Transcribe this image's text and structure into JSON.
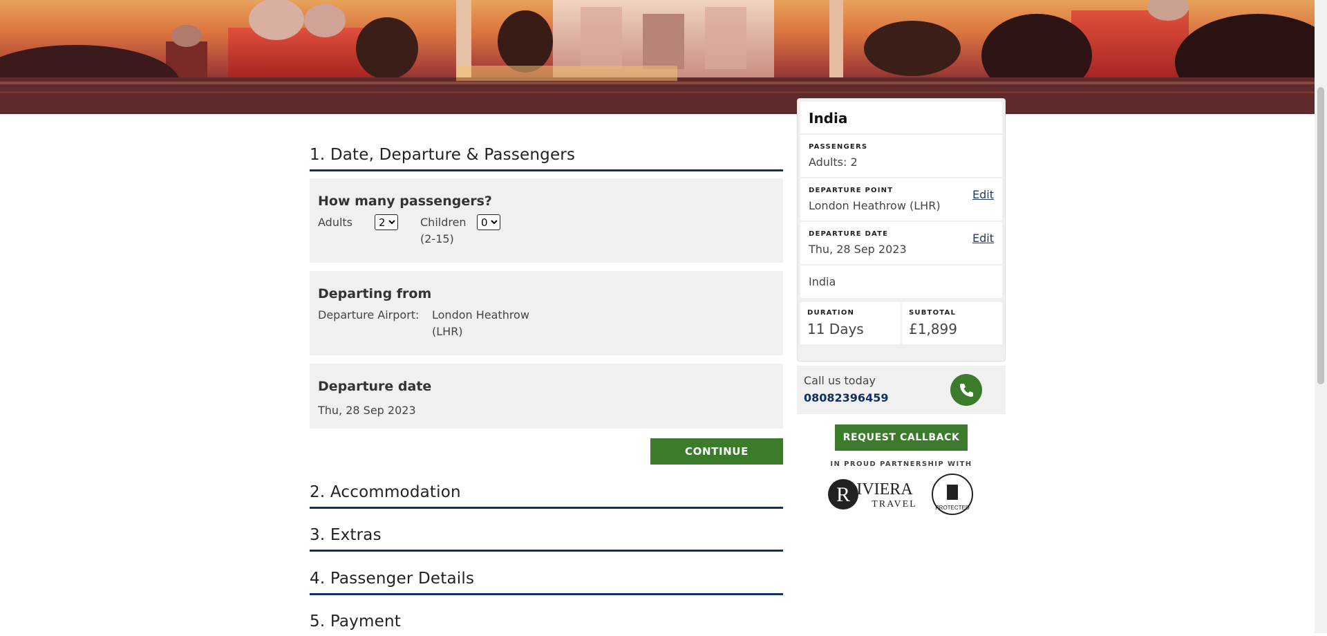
{
  "colors": {
    "accent_green": "#3c7a2c",
    "underline_navy": "#10305e",
    "link_blue": "#1c3a6e",
    "panel_gray": "#f0f0f0"
  },
  "hero": {
    "image": "taj-mahal-sunset-banner"
  },
  "steps": {
    "step1": {
      "title": "1. Date, Departure & Passengers",
      "passengers": {
        "heading": "How many passengers?",
        "adults_label": "Adults",
        "adults_value": "2",
        "children_label": "Children",
        "children_sub": "(2-15)",
        "children_value": "0"
      },
      "departing": {
        "heading": "Departing from",
        "airport_label": "Departure Airport:",
        "airport_line1": "London Heathrow",
        "airport_line2": "(LHR)"
      },
      "date": {
        "heading": "Departure date",
        "value": "Thu, 28 Sep 2023"
      },
      "continue_label": "CONTINUE"
    },
    "step2": {
      "title": "2. Accommodation"
    },
    "step3": {
      "title": "3. Extras"
    },
    "step4": {
      "title": "4. Passenger Details"
    },
    "step5": {
      "title": "5. Payment"
    }
  },
  "summary": {
    "title": "India",
    "passengers_caption": "PASSENGERS",
    "passengers_value": "Adults: 2",
    "departure_point_caption": "DEPARTURE POINT",
    "departure_point_value": "London Heathrow (LHR)",
    "departure_date_caption": "DEPARTURE DATE",
    "departure_date_value": "Thu, 28 Sep 2023",
    "edit_label": "Edit",
    "destination": "India",
    "duration_caption": "DURATION",
    "duration_value": "11 Days",
    "subtotal_caption": "SUBTOTAL",
    "subtotal_value": "£1,899"
  },
  "contact": {
    "call_text": "Call us today",
    "phone": "08082396459",
    "callback_label": "REQUEST CALLBACK"
  },
  "partnership": {
    "caption": "IN PROUD PARTNERSHIP WITH",
    "logo_text": "RIVIERA",
    "logo_sub": "TRAVEL",
    "badge_text": "PROTECTED"
  }
}
